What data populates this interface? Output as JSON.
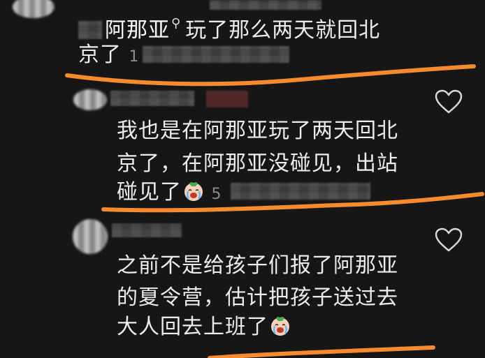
{
  "comments": [
    {
      "author_mention": "阿那亚",
      "line1": "玩了那么两天就回北",
      "line2": "京了",
      "meta_fragment": "1"
    },
    {
      "line1": "我也是在阿那亚玩了两天回北",
      "line2": "京了，在阿那亚没碰见，出站",
      "line3": "碰见了",
      "emoji": "crying-face",
      "meta_fragment": "5"
    },
    {
      "line1": "之前不是给孩子们报了阿那亚",
      "line2": "的夏令营，估计把孩子送过去",
      "line3": "大人回去上班了",
      "emoji": "crying-face"
    }
  ],
  "colors": {
    "background": "#161616",
    "text": "#ededed",
    "highlight_underline": "#f58a2f",
    "heart_outline": "#d8d8d8"
  }
}
